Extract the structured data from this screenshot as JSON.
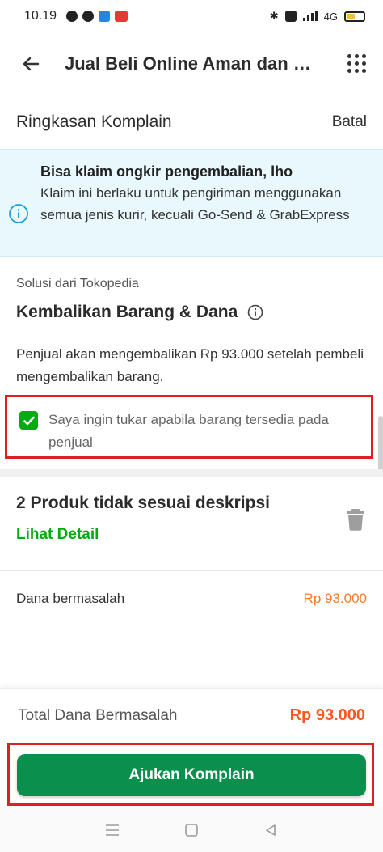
{
  "status_bar": {
    "time": "10.19",
    "network": "4G"
  },
  "header": {
    "title": "Jual Beli Online Aman dan Nyaman",
    "back_icon": "arrow-left-icon",
    "menu_icon": "grid-dots-icon"
  },
  "summary": {
    "title": "Ringkasan Komplain",
    "cancel_label": "Batal"
  },
  "info_banner": {
    "title": "Bisa klaim ongkir pengembalian, lho",
    "body": "Klaim ini berlaku untuk pengiriman menggunakan semua jenis kurir, kecuali Go-Send & GrabExpress",
    "icon": "info-icon"
  },
  "solution": {
    "label": "Solusi dari Tokopedia",
    "name": "Kembalikan Barang & Dana",
    "description": "Penjual akan mengembalikan Rp 93.000 setelah pembeli mengembalikan barang."
  },
  "exchange_option": {
    "checked": true,
    "label": "Saya ingin tukar apabila barang tersedia pada penjual"
  },
  "product": {
    "title": "2 Produk tidak sesuai deskripsi",
    "detail_link": "Lihat Detail",
    "delete_icon": "trash-icon"
  },
  "amount": {
    "label": "Dana bermasalah",
    "value": "Rp 93.000"
  },
  "total": {
    "label": "Total Dana Bermasalah",
    "value": "Rp 93.000"
  },
  "submit": {
    "label": "Ajukan Komplain"
  },
  "colors": {
    "brand_green": "#03ac0e",
    "button_green": "#0a8f4c",
    "orange": "#fa591d",
    "highlight_red": "#e02020",
    "info_bg": "#e9f8fd"
  }
}
